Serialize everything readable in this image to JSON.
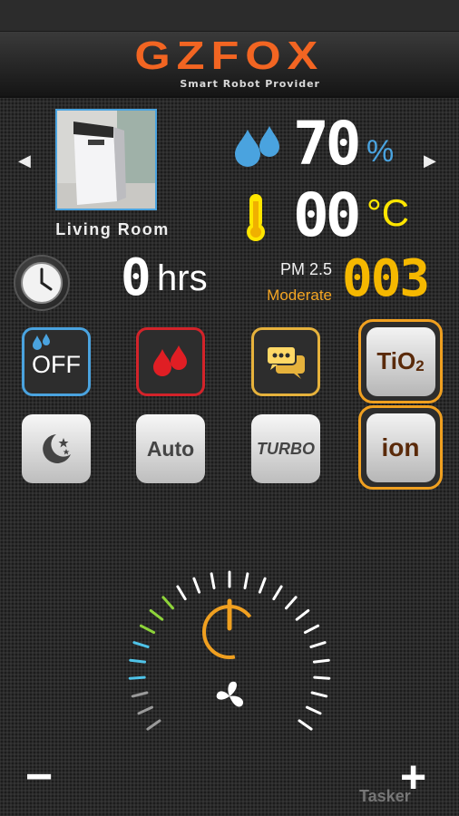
{
  "brand": {
    "logo": "GZFOX",
    "tagline": "Smart Robot Provider"
  },
  "room": {
    "label": "Living Room"
  },
  "humidity": {
    "value": "70",
    "unit": "%"
  },
  "temperature": {
    "value": "00",
    "unit": "°C"
  },
  "timer": {
    "value": "0",
    "unit": "hrs"
  },
  "pm25": {
    "label": "PM 2.5",
    "level": "Moderate",
    "value": "003"
  },
  "buttons": {
    "off": "OFF",
    "tio2_base": "TiO",
    "tio2_sub": "2",
    "auto": "Auto",
    "turbo": "TURBO",
    "ion": "ion"
  },
  "controls": {
    "minus": "−",
    "plus": "+"
  },
  "watermark": "Tasker",
  "colors": {
    "accent_blue": "#4aa3df",
    "accent_orange": "#f26522",
    "accent_yellow": "#ffe600",
    "pm_amber": "#f5b800",
    "power_orange": "#f0a020"
  }
}
